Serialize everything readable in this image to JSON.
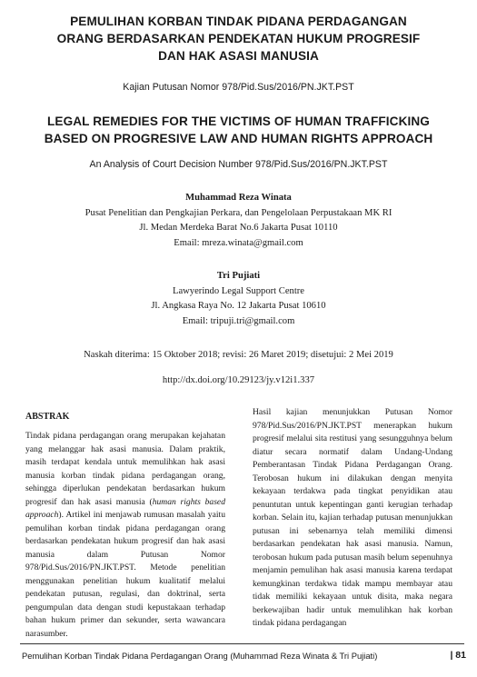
{
  "title_id": {
    "line1": "PEMULIHAN KORBAN TINDAK PIDANA PERDAGANGAN",
    "line2": "ORANG BERDASARKAN PENDEKATAN HUKUM PROGRESIF",
    "line3": "DAN HAK ASASI MANUSIA"
  },
  "subtitle_id": "Kajian Putusan Nomor 978/Pid.Sus/2016/PN.JKT.PST",
  "title_en": {
    "line1": "LEGAL REMEDIES FOR THE VICTIMS OF HUMAN TRAFFICKING",
    "line2": "BASED ON PROGRESIVE LAW AND HUMAN RIGHTS APPROACH"
  },
  "subtitle_en": "An Analysis of Court Decision Number 978/Pid.Sus/2016/PN.JKT.PST",
  "authors": [
    {
      "name": "Muhammad Reza Winata",
      "affiliation": "Pusat Penelitian dan Pengkajian Perkara, dan Pengelolaan Perpustakaan MK RI",
      "address": "Jl. Medan Merdeka Barat No.6 Jakarta Pusat 10110",
      "email": "Email: mreza.winata@gmail.com"
    },
    {
      "name": "Tri Pujiati",
      "affiliation": "Lawyerindo Legal Support Centre",
      "address": "Jl. Angkasa Raya No. 12 Jakarta Pusat 10610",
      "email": "Email: tripuji.tri@gmail.com"
    }
  ],
  "dates": "Naskah diterima: 15 Oktober 2018; revisi: 26 Maret 2019; disetujui: 2 Mei 2019",
  "doi": "http://dx.doi.org/10.29123/jy.v12i1.337",
  "abstract": {
    "heading": "ABSTRAK",
    "left_a": "Tindak pidana perdagangan orang merupakan kejahatan yang melanggar hak asasi manusia. Dalam praktik, masih terdapat kendala untuk memulihkan hak asasi manusia korban tindak pidana perdagangan orang, sehingga diperlukan pendekatan berdasarkan hukum progresif dan hak asasi manusia (",
    "left_italic1": "human rights based approach",
    "left_b": "). Artikel ini menjawab rumusan masalah yaitu pemulihan korban tindak pidana perdagangan orang berdasarkan pendekatan hukum progresif dan hak asasi manusia dalam Putusan Nomor 978/Pid.Sus/2016/PN.JKT.PST. Metode penelitian menggunakan penelitian hukum kualitatif melalui pendekatan putusan, regulasi, dan doktrinal, serta pengumpulan data dengan studi kepustakaan terhadap bahan hukum primer dan sekunder, serta wawancara narasumber.",
    "right": "Hasil kajian menunjukkan Putusan Nomor 978/Pid.Sus/2016/PN.JKT.PST menerapkan hukum progresif melalui sita restitusi yang sesungguhnya belum diatur secara normatif dalam Undang-Undang Pemberantasan Tindak Pidana Perdagangan Orang. Terobosan hukum ini dilakukan dengan menyita kekayaan terdakwa pada tingkat penyidikan atau penuntutan untuk kepentingan ganti kerugian terhadap korban. Selain itu, kajian terhadap putusan menunjukkan putusan ini sebenarnya telah memiliki dimensi berdasarkan pendekatan hak asasi manusia. Namun, terobosan hukum pada putusan masih belum sepenuhnya menjamin pemulihan hak asasi manusia karena terdapat kemungkinan terdakwa tidak mampu membayar atau tidak memiliki kekayaan untuk disita, maka negara berkewajiban hadir untuk memulihkan hak korban tindak pidana perdagangan"
  },
  "footer": {
    "running_title": "Pemulihan Korban Tindak Pidana Perdagangan Orang (Muhammad Reza Winata & Tri Pujiati)",
    "page_number": "| 81"
  }
}
